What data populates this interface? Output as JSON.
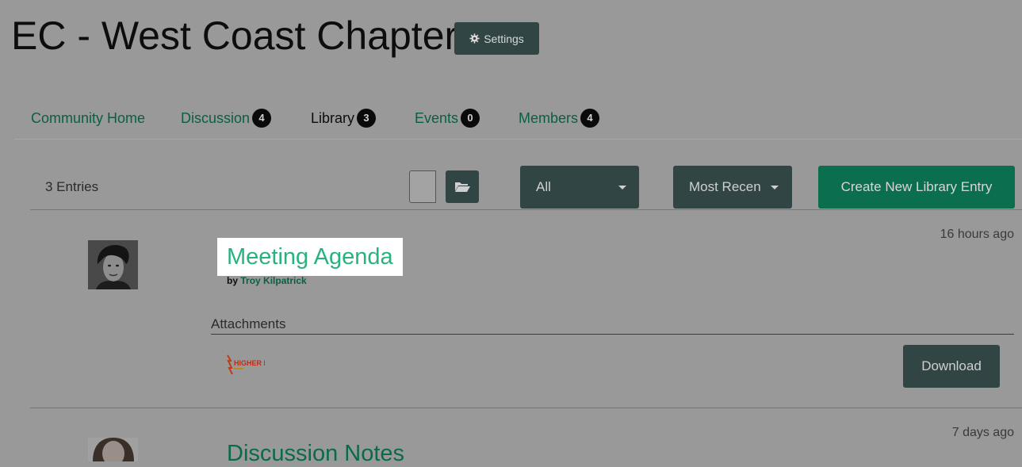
{
  "header": {
    "title": "EC - West Coast Chapter",
    "settings_label": "Settings",
    "settings_icon": "gear-icon"
  },
  "tabs": [
    {
      "label": "Community Home",
      "badge": null,
      "active": false
    },
    {
      "label": "Discussion",
      "badge": "4",
      "active": false
    },
    {
      "label": "Library",
      "badge": "3",
      "active": true
    },
    {
      "label": "Events",
      "badge": "0",
      "active": false
    },
    {
      "label": "Members",
      "badge": "4",
      "active": false
    }
  ],
  "toolbar": {
    "entries_count": "3 Entries",
    "folder_icon": "folder-open-icon",
    "filter_value": "All",
    "sort_value": "Most Recen",
    "create_label": "Create New Library Entry"
  },
  "entries": [
    {
      "title": "Meeting Agenda",
      "by_label": "by",
      "author": "Troy Kilpatrick",
      "timestamp": "16 hours ago",
      "attachments_label": "Attachments",
      "attachment_logo_text": "HIGHER LOGIC",
      "download_label": "Download"
    },
    {
      "title": "Discussion Notes",
      "timestamp": "7 days ago"
    }
  ],
  "colors": {
    "background": "#999999",
    "dark_button": "#324545",
    "primary_green": "#0b6e4f",
    "link_green": "#0b5e44",
    "title_highlight": "#28b37e"
  }
}
